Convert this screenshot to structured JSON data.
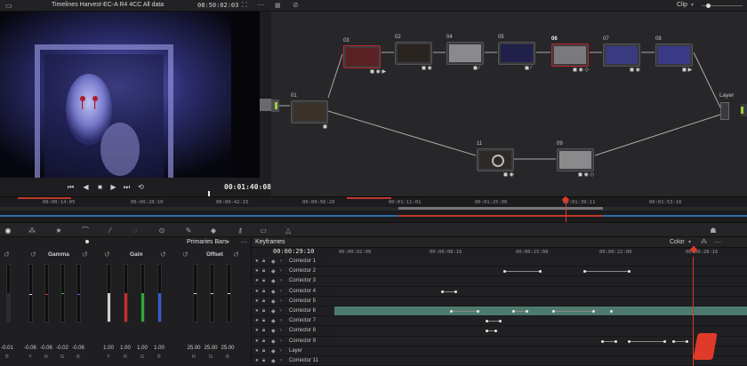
{
  "viewer": {
    "title": "Timelines Harvest-EC-A R4 4CC All data",
    "timecode": "08:50:02:03",
    "transport_timecode": "00:01:40:08"
  },
  "node_editor": {
    "clip_label": "Clip",
    "layer_label": "Layer",
    "nodes": [
      {
        "num": "01",
        "icons": "◼"
      },
      {
        "num": "03",
        "icons": "◼ ◉ ▶"
      },
      {
        "num": "02",
        "icons": "◼ ◉"
      },
      {
        "num": "04",
        "icons": "◼ ⁄"
      },
      {
        "num": "05",
        "icons": "◼ ⁄"
      },
      {
        "num": "06",
        "icons": "◼ ◉ ◇"
      },
      {
        "num": "07",
        "icons": "◼ ◉"
      },
      {
        "num": "08",
        "icons": "◼ ▶"
      },
      {
        "num": "11",
        "icons": "◼ ◉"
      },
      {
        "num": "09",
        "icons": "◼ ◉ ◇"
      }
    ]
  },
  "timeline_strip": {
    "timecodes": [
      "00:00:14:05",
      "00:00:28:10",
      "00:00:42:15",
      "00:00:56:20",
      "00:01:11:01",
      "00:01:25:06",
      "00:01:39:11",
      "00:01:53:16"
    ]
  },
  "primaries": {
    "title": "Primaries Bars",
    "groups": [
      {
        "label": "",
        "values": [
          "-0.01"
        ],
        "channels": [
          "B"
        ]
      },
      {
        "label": "Gamma",
        "values": [
          "-0.06",
          "-0.06",
          "-0.02",
          "-0.06"
        ],
        "channels": [
          "Y",
          "R",
          "G",
          "B"
        ]
      },
      {
        "label": "Gain",
        "values": [
          "1.00",
          "1.00",
          "1.00",
          "1.00"
        ],
        "channels": [
          "Y",
          "R",
          "G",
          "B"
        ]
      },
      {
        "label": "Offset",
        "values": [
          "25.00",
          "25.00",
          "25.00"
        ],
        "channels": [
          "R",
          "G",
          "B"
        ]
      }
    ]
  },
  "keyframes": {
    "title": "Keyframes",
    "mode": "Color",
    "current_timecode": "00:00:29:10",
    "ruler": [
      "00:00:02:00",
      "00:00:08:16",
      "00:00:15:08",
      "00:00:22:00",
      "00:00:28:16"
    ],
    "rows": [
      "Corrector 1",
      "Corrector 2",
      "Corrector 3",
      "Corrector 4",
      "Corrector 5",
      "Corrector 6",
      "Corrector 7",
      "Corrector 8",
      "Corrector 9",
      "Layer",
      "Corrector 11"
    ]
  },
  "colors": {
    "accent": "#e03a2a",
    "node_port_green": "#9ad13e",
    "node_port_blue": "#3fa0e0",
    "highlight_row": "#4e7a6e",
    "playhead": "#d83a2e"
  }
}
